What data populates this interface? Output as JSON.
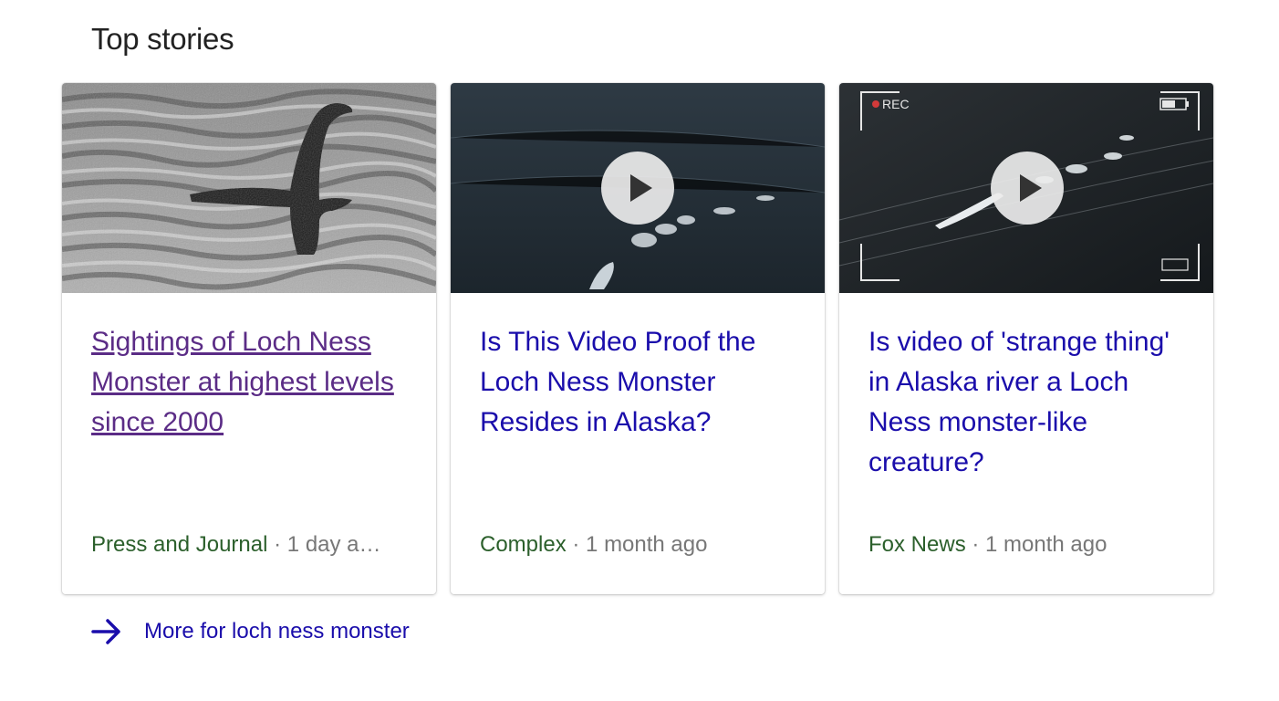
{
  "section": {
    "title": "Top stories"
  },
  "stories": [
    {
      "headline": "Sightings of Loch Ness Monster at highest levels since 2000",
      "source": "Press and Journal",
      "separator": "·",
      "time": "1 day a…",
      "is_video": false,
      "visited": true
    },
    {
      "headline": "Is This Video Proof the Loch Ness Monster Resides in Alaska?",
      "source": "Complex",
      "separator": "·",
      "time": "1 month ago",
      "is_video": true,
      "visited": false
    },
    {
      "headline": "Is video of 'strange thing' in Alaska river a Loch Ness monster-like creature?",
      "source": "Fox News",
      "separator": "·",
      "time": "1 month ago",
      "is_video": true,
      "visited": false,
      "overlay": {
        "rec_label": "REC"
      }
    }
  ],
  "more_link": {
    "label": "More for loch ness monster",
    "icon": "arrow-right-icon"
  },
  "colors": {
    "link": "#1a0dab",
    "visited": "#5b2c86",
    "source": "#2b5f2b",
    "meta": "#777777"
  }
}
